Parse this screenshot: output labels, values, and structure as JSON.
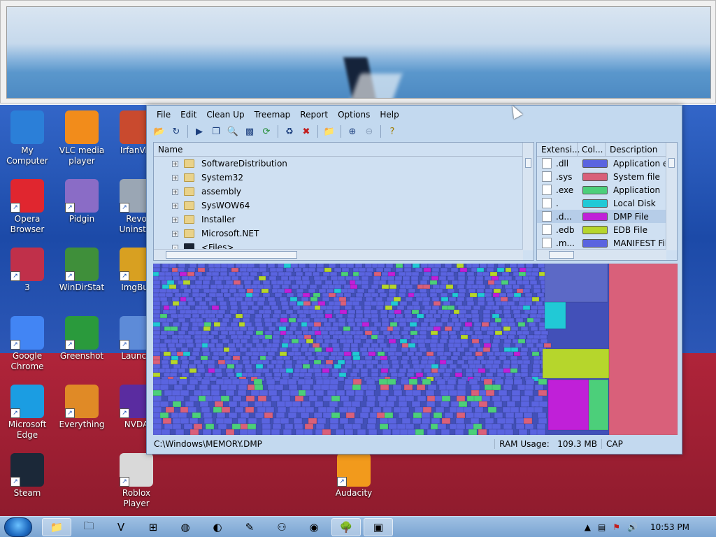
{
  "desktop": {
    "icons": [
      {
        "label": "My Computer",
        "color": "#2b7fd8"
      },
      {
        "label": "VLC media player",
        "color": "#f28c1b"
      },
      {
        "label": "IrfanVie",
        "color": "#c94a2e"
      },
      {
        "label": "Opera Browser",
        "color": "#e0262f"
      },
      {
        "label": "Pidgin",
        "color": "#8a6cc6"
      },
      {
        "label": "Revo Uninstal",
        "color": "#9aa6b4"
      },
      {
        "label": "3",
        "color": "#c0304a"
      },
      {
        "label": "WinDirStat",
        "color": "#3f8f3a"
      },
      {
        "label": "ImgBur",
        "color": "#d8a021"
      },
      {
        "label": "Google Chrome",
        "color": "#4285f4"
      },
      {
        "label": "Greenshot",
        "color": "#2a9a3c"
      },
      {
        "label": "Launch",
        "color": "#5d8bd8"
      },
      {
        "label": "Microsoft Edge",
        "color": "#1b9de2"
      },
      {
        "label": "Everything",
        "color": "#e08a26"
      },
      {
        "label": "NVDA",
        "color": "#5a2ca0"
      },
      {
        "label": "Steam",
        "color": "#1b2838"
      },
      {
        "label": "Roblox Player",
        "color": "#d9d9d9"
      },
      {
        "label": "Audacity",
        "color": "#f29a1c"
      }
    ]
  },
  "window": {
    "menu": [
      "File",
      "Edit",
      "Clean Up",
      "Treemap",
      "Report",
      "Options",
      "Help"
    ],
    "toolbar_icons": [
      "open-folder-icon",
      "refresh-icon",
      "play-icon",
      "copy-icon",
      "explore-icon",
      "cmd-icon",
      "reload-icon",
      "recycle-icon",
      "delete-icon",
      "new-folder-icon",
      "zoom-in-icon",
      "zoom-out-icon",
      "help-icon"
    ],
    "tree": {
      "header": "Name",
      "rows": [
        "SoftwareDistribution",
        "System32",
        "assembly",
        "SysWOW64",
        "Installer",
        "Microsoft.NET",
        "<Files>"
      ]
    },
    "extensions": {
      "headers": [
        "Extensi...",
        "Col...",
        "Description"
      ],
      "rows": [
        {
          "ext": ".dll",
          "color": "#5a64e0",
          "desc": "Application ext"
        },
        {
          "ext": ".sys",
          "color": "#d9607a",
          "desc": "System file"
        },
        {
          "ext": ".exe",
          "color": "#4ccf7a",
          "desc": "Application"
        },
        {
          "ext": ".",
          "color": "#21c9d6",
          "desc": "Local Disk"
        },
        {
          "ext": ".d...",
          "color": "#c020d8",
          "desc": "DMP File",
          "selected": true
        },
        {
          "ext": ".edb",
          "color": "#b6d62c",
          "desc": "EDB File"
        },
        {
          "ext": ".m...",
          "color": "#5a64e0",
          "desc": "MANIFEST File"
        }
      ]
    },
    "status": {
      "path": "C:\\Windows\\MEMORY.DMP",
      "ram_label": "RAM Usage:",
      "ram_value": "109.3 MB",
      "caps": "CAP"
    }
  },
  "taskbar": {
    "apps": [
      "file-explorer-icon",
      "folder-icon",
      "vmware-icon",
      "windows-icon",
      "paint-icon",
      "browser-icon",
      "pencil-icon",
      "putty-icon",
      "edge-icon",
      "windirstat-icon",
      "remote-icon"
    ],
    "clock": "10:53 PM"
  }
}
